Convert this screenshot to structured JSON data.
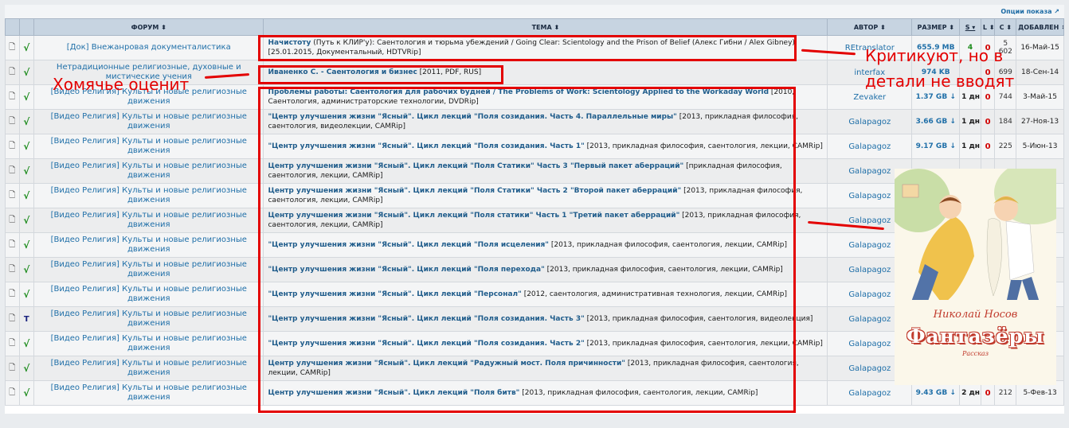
{
  "options_label": "Опции показа",
  "headers": {
    "forum": "ФОРУМ ⬍",
    "topic": "ТЕМА ⬍",
    "author": "АВТОР ⬍",
    "size": "РАЗМЕР ⬍",
    "s": "S ▾",
    "l": "L ⬍",
    "c": "С ⬍",
    "added": "ДОБАВЛЕН ⬍"
  },
  "rows": [
    {
      "status": "√",
      "forum": "[Док] Внежанровая документалистика",
      "title": "Начистоту",
      "rest": " (Путь к КЛИР'у): Саентология и тюрьма убеждений / Going Clear: Scientology and the Prison of Belief (Алекс Гибни / Alex Gibney) [25.01.2015, Документальный, HDTVRip]",
      "author": "REtranslator",
      "size": "655.9 MB",
      "seeds": "4",
      "leech": "0",
      "completed": "5 602",
      "date": "16-Май-15"
    },
    {
      "status": "√",
      "forum": "Нетрадиционные религиозные, духовные и мистические учения",
      "title": "Иваненко С. - Саентология и бизнес",
      "rest": " [2011, PDF, RUS]",
      "author": "interfax",
      "size": "974 KB",
      "seeds": "",
      "leech": "0",
      "completed": "699",
      "date": "18-Сен-14"
    },
    {
      "status": "√",
      "forum": "[Видео Религия] Культы и новые религиозные движения",
      "title": "Проблемы работы: Саентология для рабочих будней / The Problems of Work: Scientology Applied to the Workaday World",
      "rest": " [2010, Саентология, администраторские технологии, DVDRip]",
      "author": "Zevaker",
      "size": "1.37 GB ↓",
      "seeds": "1 дн.",
      "leech": "0",
      "completed": "744",
      "date": "3-Май-15"
    },
    {
      "status": "√",
      "forum": "[Видео Религия] Культы и новые религиозные движения",
      "title": "\"Центр улучшения жизни \"Ясный\". Цикл лекций \"Поля созидания. Часть 4. Параллельные миры\"",
      "rest": " [2013, прикладная философия, саентология, видеолекции, CAMRip]",
      "author": "Galapagoz",
      "size": "3.66 GB ↓",
      "seeds": "1 дн.",
      "leech": "0",
      "completed": "184",
      "date": "27-Ноя-13"
    },
    {
      "status": "√",
      "forum": "[Видео Религия] Культы и новые религиозные движения",
      "title": "\"Центр улучшения жизни \"Ясный\". Цикл лекций \"Поля созидания. Часть 1\"",
      "rest": " [2013, прикладная философия, саентология, лекции, CAMRip]",
      "author": "Galapagoz",
      "size": "9.17 GB ↓",
      "seeds": "1 дн.",
      "leech": "0",
      "completed": "225",
      "date": "5-Июн-13"
    },
    {
      "status": "√",
      "forum": "[Видео Религия] Культы и новые религиозные движения",
      "title": "Центр улучшения жизни \"Ясный\". Цикл лекций \"Поля Статики\" Часть 3 \"Первый пакет аберраций\"",
      "rest": " [прикладная философия, саентология, лекции, CAMRip]",
      "author": "Galapagoz",
      "size": "",
      "seeds": "",
      "leech": "",
      "completed": "",
      "date": ""
    },
    {
      "status": "√",
      "forum": "[Видео Религия] Культы и новые религиозные движения",
      "title": "Центр улучшения жизни \"Ясный\". Цикл лекций \"Поля Статики\" Часть 2 \"Второй пакет аберраций\"",
      "rest": " [2013, прикладная философия, саентология, лекции, CAMRip]",
      "author": "Galapagoz",
      "size": "",
      "seeds": "",
      "leech": "",
      "completed": "",
      "date": ""
    },
    {
      "status": "√",
      "forum": "[Видео Религия] Культы и новые религиозные движения",
      "title": "Центр улучшения жизни \"Ясный\". Цикл лекций \"Поля статики\" Часть 1 \"Третий пакет аберраций\"",
      "rest": " [2013, прикладная философия, саентология, лекции, CAMRip]",
      "author": "Galapagoz",
      "size": "",
      "seeds": "",
      "leech": "",
      "completed": "",
      "date": ""
    },
    {
      "status": "√",
      "forum": "[Видео Религия] Культы и новые религиозные движения",
      "title": "\"Центр улучшения жизни \"Ясный\". Цикл лекций \"Поля исцеления\"",
      "rest": " [2013, прикладная философия, саентология, лекции, CAMRip]",
      "author": "Galapagoz",
      "size": "",
      "seeds": "",
      "leech": "",
      "completed": "",
      "date": ""
    },
    {
      "status": "√",
      "forum": "[Видео Религия] Культы и новые религиозные движения",
      "title": "\"Центр улучшения жизни \"Ясный\". Цикл лекций \"Поля перехода\"",
      "rest": " [2013, прикладная философия, саентология, лекции, CAMRip]",
      "author": "Galapagoz",
      "size": "",
      "seeds": "",
      "leech": "",
      "completed": "",
      "date": ""
    },
    {
      "status": "√",
      "forum": "[Видео Религия] Культы и новые религиозные движения",
      "title": "\"Центр улучшения жизни \"Ясный\". Цикл лекций \"Персонал\"",
      "rest": " [2012, саентология, административная технология, лекции, CAMRip]",
      "author": "Galapagoz",
      "size": "",
      "seeds": "",
      "leech": "",
      "completed": "",
      "date": ""
    },
    {
      "status": "T",
      "forum": "[Видео Религия] Культы и новые религиозные движения",
      "title": "\"Центр улучшения жизни \"Ясный\". Цикл лекций \"Поля созидания. Часть 3\"",
      "rest": " [2013, прикладная философия, саентология, видеолекция]",
      "author": "Galapagoz",
      "size": "",
      "seeds": "",
      "leech": "",
      "completed": "",
      "date": ""
    },
    {
      "status": "√",
      "forum": "[Видео Религия] Культы и новые религиозные движения",
      "title": "\"Центр улучшения жизни \"Ясный\". Цикл лекций \"Поля созидания. Часть 2\"",
      "rest": " [2013, прикладная философия, саентология, лекции, CAMRip]",
      "author": "Galapagoz",
      "size": "",
      "seeds": "",
      "leech": "",
      "completed": "",
      "date": ""
    },
    {
      "status": "√",
      "forum": "[Видео Религия] Культы и новые религиозные движения",
      "title": "Центр улучшения жизни \"Ясный\". Цикл лекций \"Радужный мост. Поля причинности\"",
      "rest": " [2013, прикладная философия, саентология, лекции, CAMRip]",
      "author": "Galapagoz",
      "size": "",
      "seeds": "",
      "leech": "",
      "completed": "",
      "date": ""
    },
    {
      "status": "√",
      "forum": "[Видео Религия] Культы и новые религиозные движения",
      "title": "Центр улучшения жизни \"Ясный\". Цикл лекций \"Поля битв\"",
      "rest": " [2013, прикладная философия, саентология, лекции, CAMRip]",
      "author": "Galapagoz",
      "size": "9.43 GB ↓",
      "seeds": "2 дн.",
      "leech": "0",
      "completed": "212",
      "date": "5-Фев-13"
    }
  ],
  "annotations": {
    "critic_line1": "Критикуют, но в",
    "critic_line2": "детали не вводят",
    "hamster": "Хомячье оценит"
  },
  "book": {
    "author": "Николай Носов",
    "title": "Фантазёры",
    "subtitle": "Рассказ"
  },
  "colors": {
    "annotation": "#e30000",
    "link": "#1f6fa8",
    "header_bg": "#c7d4e1"
  }
}
